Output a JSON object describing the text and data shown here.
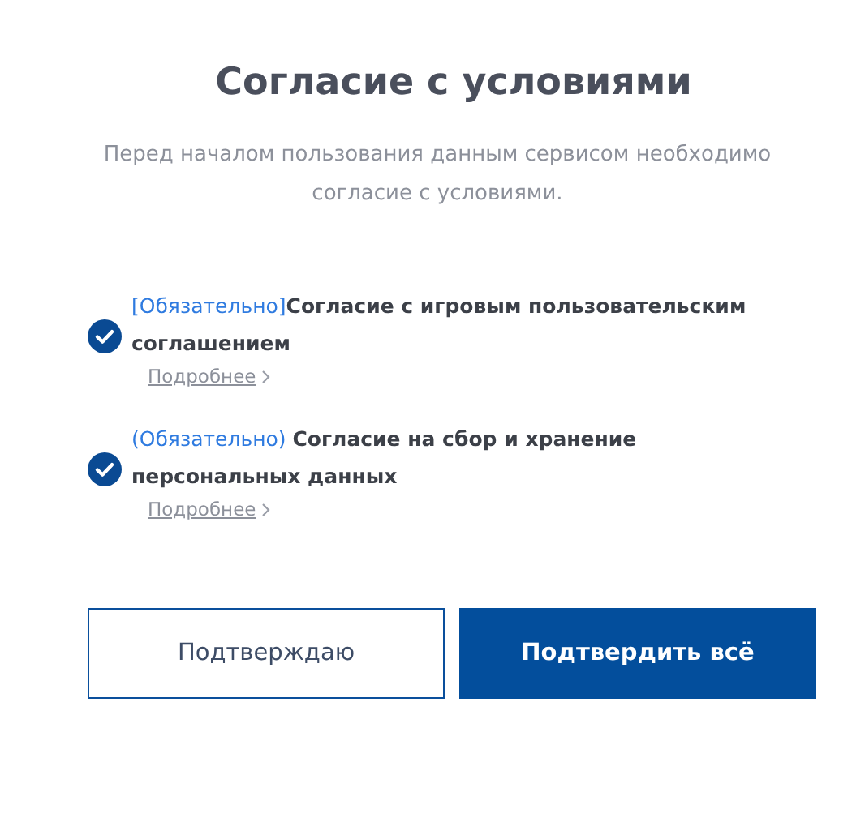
{
  "title": "Согласие с условиями",
  "subtitle": "Перед началом пользования данным сервисом необходимо согласие с условиями.",
  "agreements": [
    {
      "tag": "[Обязательно]",
      "text": "Согласие с игровым пользовательским соглашением",
      "checked": true,
      "more": "Подробнее"
    },
    {
      "tag": "(Обязательно) ",
      "text": "Согласие на сбор и хранение персональных данных",
      "checked": true,
      "more": "Подробнее"
    }
  ],
  "buttons": [
    {
      "label": "Подтверждаю",
      "kind": "outline"
    },
    {
      "label": "Подтвердить всё",
      "kind": "primary"
    }
  ]
}
